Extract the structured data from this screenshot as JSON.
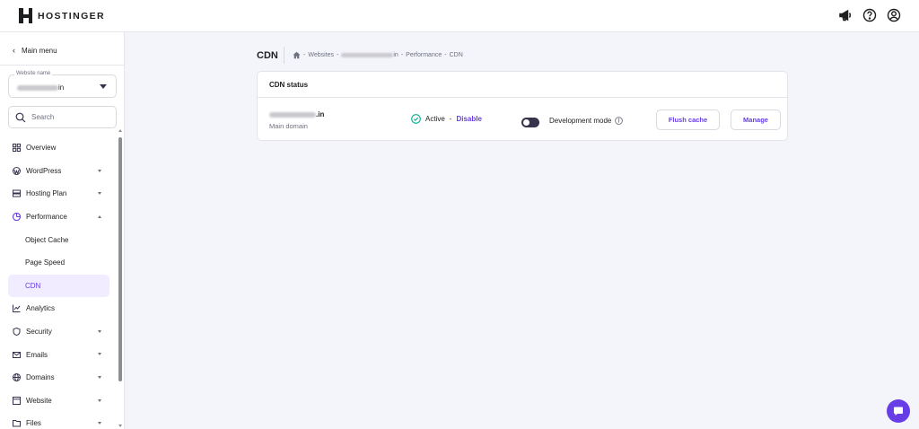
{
  "brand": {
    "name": "HOSTINGER"
  },
  "topbar": {
    "icons": [
      "megaphone-icon",
      "help-icon",
      "account-icon"
    ]
  },
  "sidebar": {
    "back_label": "Main menu",
    "site_select": {
      "label": "Website name",
      "value_suffix": "in"
    },
    "search": {
      "placeholder": "Search"
    },
    "items": [
      {
        "label": "Overview",
        "icon": "overview-icon"
      },
      {
        "label": "WordPress",
        "icon": "wordpress-icon",
        "expandable": true
      },
      {
        "label": "Hosting Plan",
        "icon": "hosting-plan-icon",
        "expandable": true
      },
      {
        "label": "Performance",
        "icon": "performance-icon",
        "expanded": true
      },
      {
        "label": "Object Cache"
      },
      {
        "label": "Page Speed"
      },
      {
        "label": "CDN",
        "active": true
      },
      {
        "label": "Analytics",
        "icon": "analytics-icon"
      },
      {
        "label": "Security",
        "icon": "shield-icon",
        "expandable": true
      },
      {
        "label": "Emails",
        "icon": "email-icon",
        "expandable": true
      },
      {
        "label": "Domains",
        "icon": "globe-icon",
        "expandable": true
      },
      {
        "label": "Website",
        "icon": "website-icon",
        "expandable": true
      },
      {
        "label": "Files",
        "icon": "folder-icon",
        "expandable": true
      }
    ]
  },
  "main": {
    "title": "CDN",
    "breadcrumb": {
      "sep1": "-",
      "websites": "Websites",
      "sep2": "-",
      "site_suffix": "in",
      "sep3": "-",
      "performance": "Performance",
      "sep4": "-",
      "current": "CDN"
    },
    "card": {
      "title": "CDN status",
      "domain_suffix": ".in",
      "domain_sub": "Main domain",
      "status_text": "Active",
      "status_sep": "-",
      "disable_label": "Disable",
      "dev_mode_label": "Development mode",
      "flush_label": "Flush cache",
      "manage_label": "Manage"
    }
  },
  "colors": {
    "accent": "#673de6",
    "success": "#00b090",
    "toggle": "#36344d"
  }
}
